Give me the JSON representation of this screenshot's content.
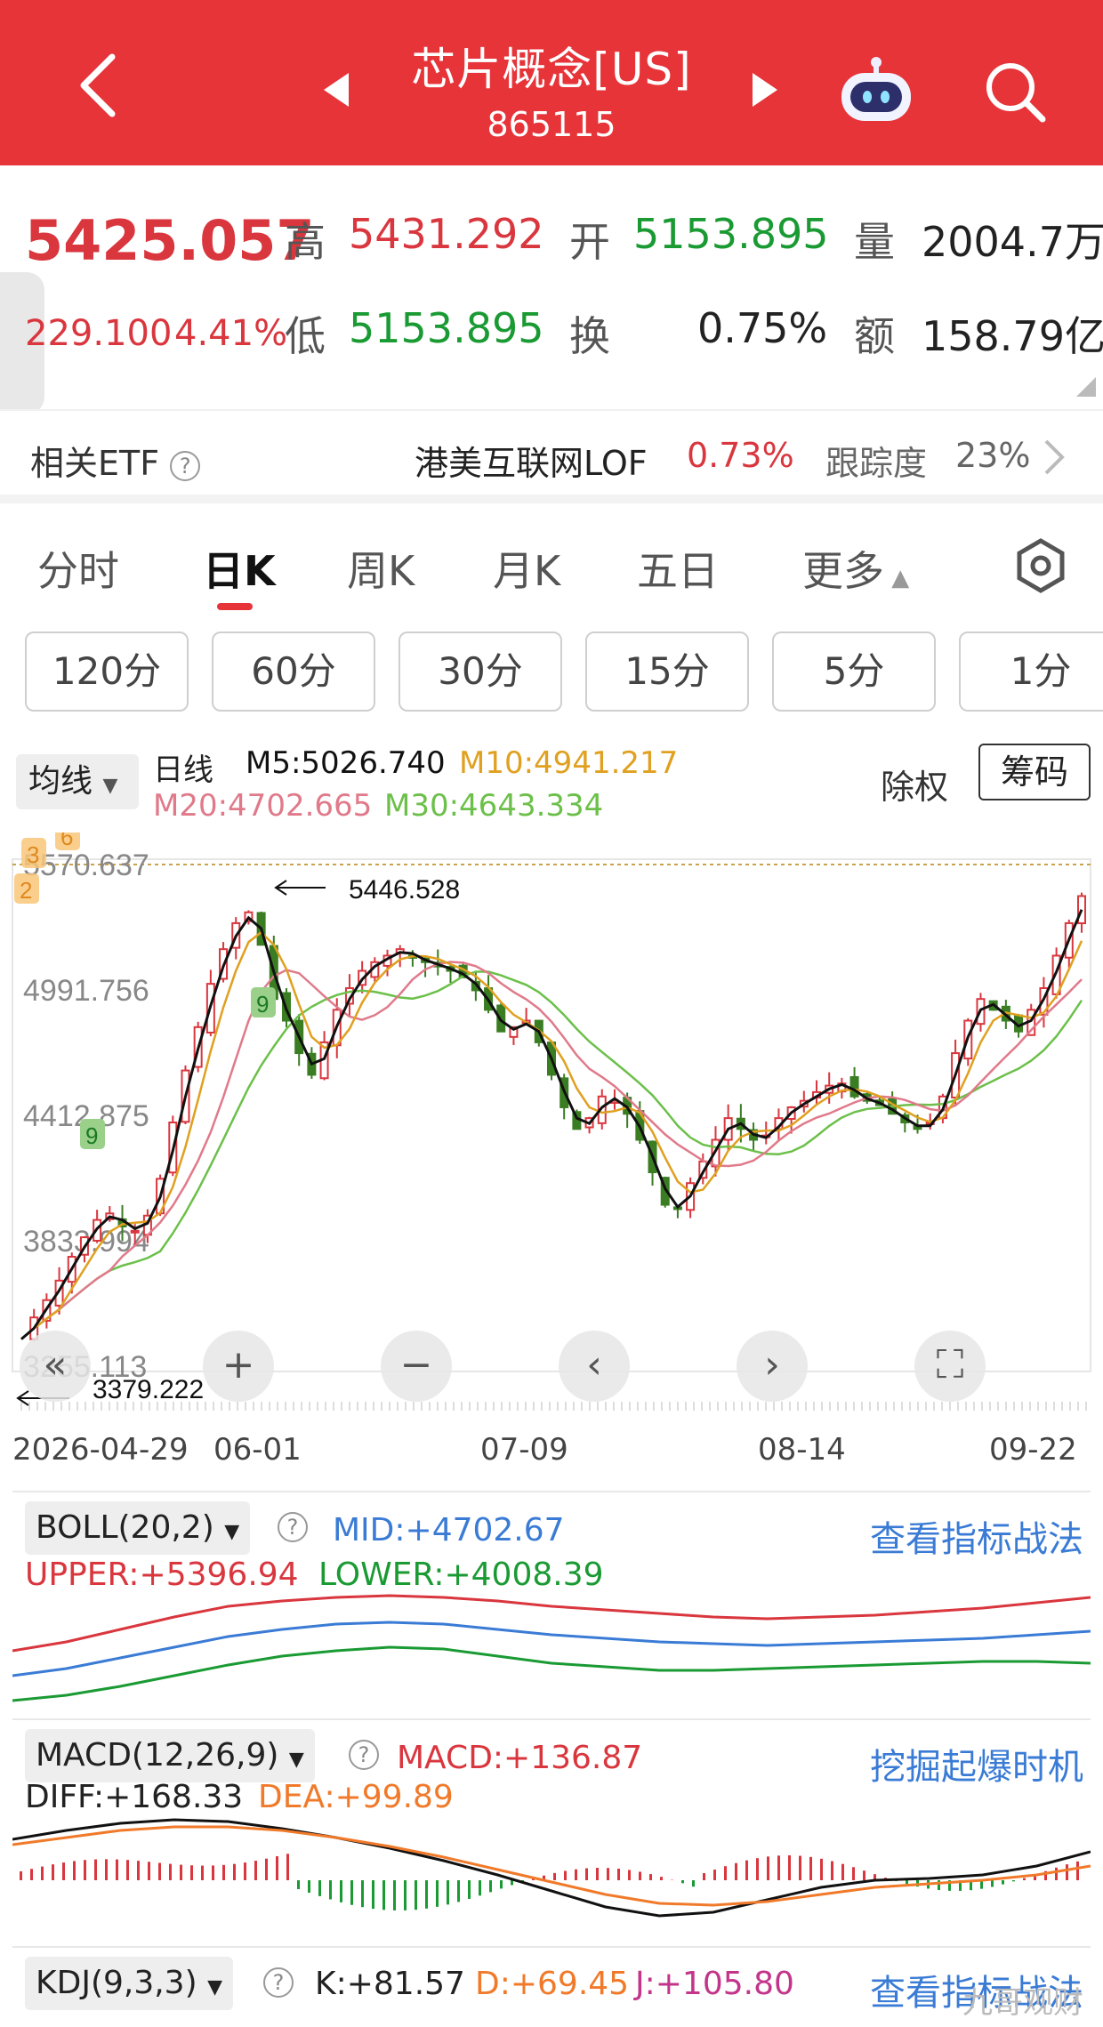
{
  "header": {
    "title": "芯片概念[US]",
    "code": "865115"
  },
  "quote": {
    "price": "5425.057",
    "change": "229.100",
    "change_pct": "4.41%",
    "high_label": "高",
    "high": "5431.292",
    "low_label": "低",
    "low": "5153.895",
    "open_label": "开",
    "open": "5153.895",
    "turnover_label": "换",
    "turnover": "0.75%",
    "volume_label": "量",
    "volume": "2004.7万",
    "amount_label": "额",
    "amount": "158.79亿"
  },
  "etf": {
    "label": "相关ETF",
    "name": "港美互联网LOF",
    "pct": "0.73%",
    "track_label": "跟踪度",
    "track": "23%"
  },
  "tabs": [
    "分时",
    "日K",
    "周K",
    "月K",
    "五日",
    "更多"
  ],
  "intervals": [
    "120分",
    "60分",
    "30分",
    "15分",
    "5分",
    "1分"
  ],
  "ma": {
    "selector": "均线",
    "period": "日线",
    "m5": "M5:5026.740",
    "m10": "M10:4941.217",
    "m20": "M20:4702.665",
    "m30": "M30:4643.334",
    "exright": "除权",
    "chips": "筹码"
  },
  "chart_data": {
    "type": "candlestick",
    "y_ticks": [
      "5570.637",
      "4991.756",
      "4412.875",
      "3833.994",
      "3255.113"
    ],
    "ylim": [
      3255.113,
      5570.637
    ],
    "max_label": "5446.528",
    "min_label": "3379.222",
    "x_labels": [
      "2026-04-29",
      "06-01",
      "07-09",
      "08-14",
      "09-22"
    ],
    "series_colors": {
      "M5": "#111111",
      "M10": "#e0a020",
      "M20": "#e07a8a",
      "M30": "#6cc04a"
    },
    "trend_close": [
      3380,
      3480,
      3560,
      3650,
      3760,
      3850,
      3930,
      3960,
      3900,
      3880,
      3950,
      4120,
      4380,
      4620,
      4820,
      5020,
      5180,
      5300,
      5350,
      5200,
      4950,
      4850,
      4700,
      4600,
      4750,
      4900,
      5000,
      5080,
      5120,
      5150,
      5180,
      5140,
      5120,
      5100,
      5080,
      5050,
      4990,
      4900,
      4800,
      4820,
      4850,
      4750,
      4600,
      4450,
      4350,
      4400,
      4500,
      4480,
      4420,
      4300,
      4150,
      4000,
      3980,
      4100,
      4200,
      4300,
      4400,
      4350,
      4300,
      4320,
      4400,
      4450,
      4480,
      4520,
      4550,
      4560,
      4500,
      4480,
      4460,
      4420,
      4380,
      4350,
      4380,
      4500,
      4700,
      4850,
      4950,
      4900,
      4850,
      4800,
      4900,
      5000,
      5150,
      5300,
      5425
    ]
  },
  "controls": [
    "«",
    "+",
    "−",
    "‹",
    "›",
    "⛶"
  ],
  "boll": {
    "name": "BOLL(20,2)",
    "mid": "MID:+4702.67",
    "upper": "UPPER:+5396.94",
    "lower": "LOWER:+4008.39",
    "link": "查看指标战法"
  },
  "macd": {
    "name": "MACD(12,26,9)",
    "macd": "MACD:+136.87",
    "diff": "DIFF:+168.33",
    "dea": "DEA:+99.89",
    "link": "挖掘起爆时机"
  },
  "kdj": {
    "name": "KDJ(9,3,3)",
    "k": "K:+81.57",
    "d": "D:+69.45",
    "j": "J:+105.80",
    "link": "查看指标战法"
  },
  "watermark": "九哥观财"
}
